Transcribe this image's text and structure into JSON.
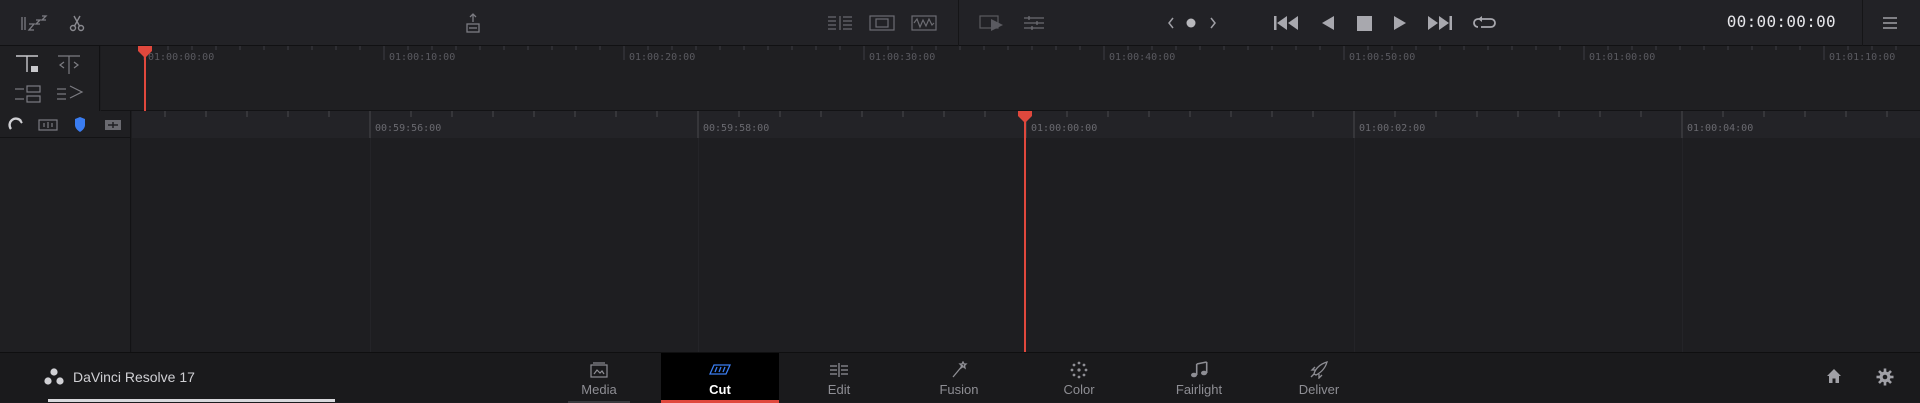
{
  "toolbar": {
    "left_icons": [
      "sleep-icon",
      "scissors-icon",
      "unlink-icon"
    ],
    "view_icons": [
      "view-list-icon",
      "view-clip-icon",
      "view-waveform-icon"
    ],
    "middle_icons": [
      "playback-icon",
      "settings-sliders-icon"
    ],
    "timecode": "00:00:00:00"
  },
  "upper_ruler": {
    "labels": [
      "01:00:00:00",
      "01:00:10:00",
      "01:00:20:00",
      "01:00:30:00",
      "01:00:40:00",
      "01:00:50:00",
      "01:01:00:00",
      "01:01:10:00"
    ]
  },
  "lower_ruler": {
    "labels": [
      "00:59:56:00",
      "00:59:58:00",
      "01:00:00:00",
      "01:00:02:00",
      "01:00:04:00"
    ]
  },
  "colors": {
    "playhead": "#e0483d",
    "accent_blue": "#3a7cf0"
  },
  "app": {
    "name": "DaVinci Resolve 17"
  },
  "pages": [
    {
      "label": "Media",
      "icon": "media-icon",
      "active": false
    },
    {
      "label": "Cut",
      "icon": "cut-icon",
      "active": true
    },
    {
      "label": "Edit",
      "icon": "edit-icon",
      "active": false
    },
    {
      "label": "Fusion",
      "icon": "fusion-icon",
      "active": false
    },
    {
      "label": "Color",
      "icon": "color-icon",
      "active": false
    },
    {
      "label": "Fairlight",
      "icon": "fairlight-icon",
      "active": false
    },
    {
      "label": "Deliver",
      "icon": "deliver-icon",
      "active": false
    }
  ]
}
